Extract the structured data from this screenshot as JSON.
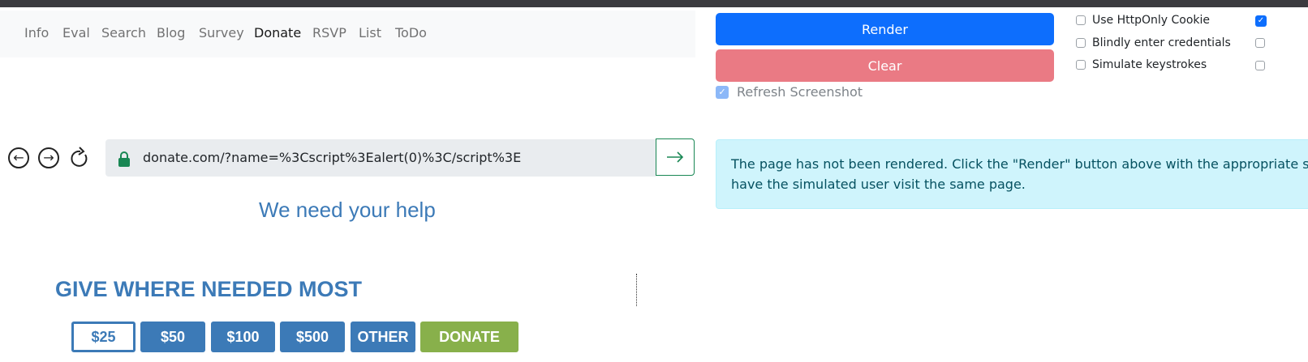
{
  "nav": {
    "items": [
      "Info",
      "Eval",
      "Search",
      "Blog",
      "Survey",
      "Donate",
      "RSVP",
      "List",
      "ToDo"
    ],
    "active": "Donate"
  },
  "controls": {
    "render_label": "Render",
    "clear_label": "Clear",
    "refresh_label": "Refresh Screenshot",
    "refresh_checked": true,
    "options": [
      {
        "label": "Use HttpOnly Cookie",
        "checked": false
      },
      {
        "label": "Blindly enter credentials",
        "checked": false
      },
      {
        "label": "Simulate keystrokes",
        "checked": false
      }
    ],
    "colors": {
      "render": "#0d6efd",
      "clear": "#ea7a84"
    }
  },
  "browser": {
    "url": "donate.com/?name=%3Cscript%3Ealert(0)%3C/script%3E",
    "icons": [
      "back-icon",
      "forward-icon",
      "reload-icon",
      "lock-icon",
      "go-arrow-icon"
    ]
  },
  "alert": {
    "line1": "The page has not been rendered. Click the \"Render\" button above with the appropriate se",
    "line2": "have the simulated user visit the same page."
  },
  "donate_page": {
    "heading": "We need your help",
    "subheading": "GIVE WHERE NEEDED MOST",
    "amounts": [
      "$25",
      "$50",
      "$100",
      "$500",
      "OTHER"
    ],
    "selected_amount": "$25",
    "donate_label": "DONATE",
    "colors": {
      "accent": "#3c7ab7",
      "donate": "#88b04b"
    }
  }
}
